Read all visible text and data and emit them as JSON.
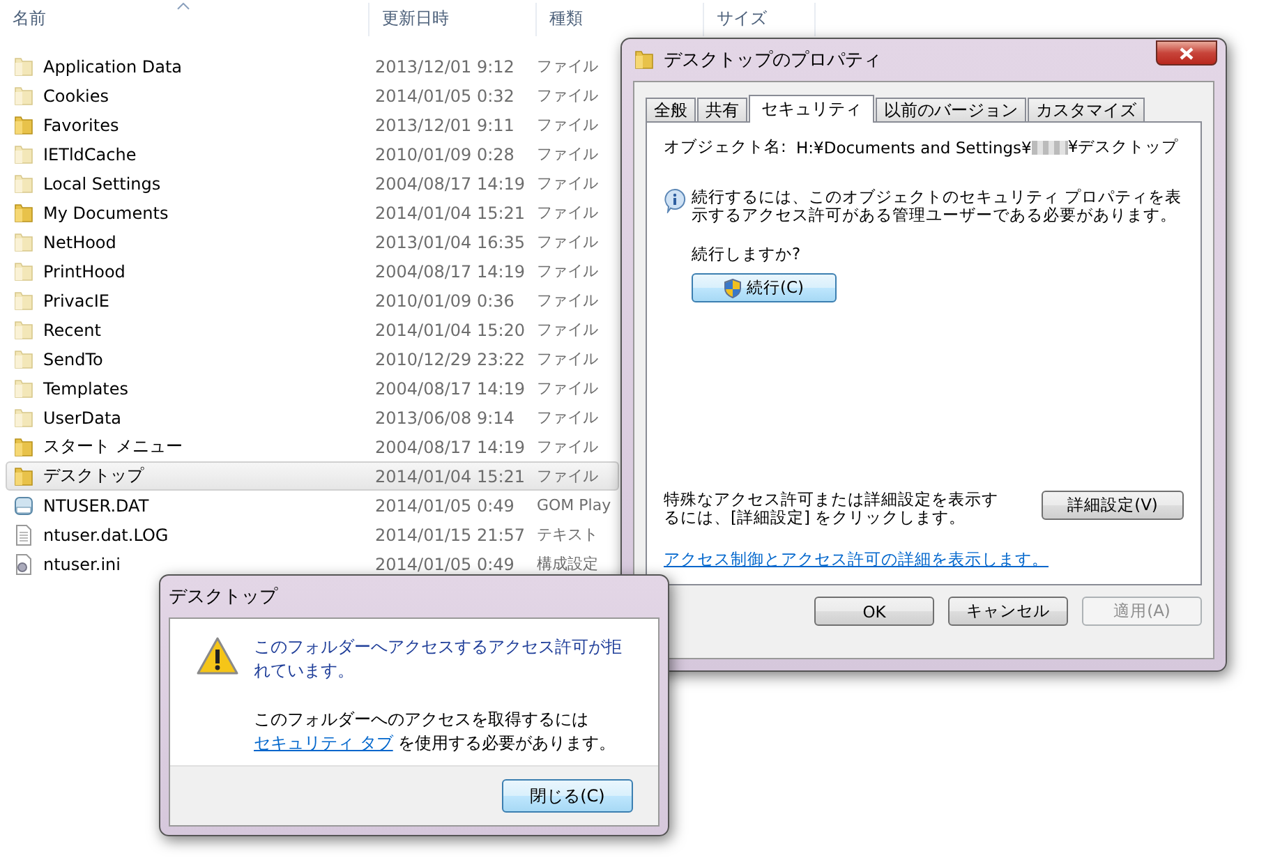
{
  "explorer": {
    "columns": [
      {
        "label": "名前",
        "sorted": true
      },
      {
        "label": "更新日時",
        "sorted": false
      },
      {
        "label": "種類",
        "sorted": false
      },
      {
        "label": "サイズ",
        "sorted": false
      }
    ],
    "rows": [
      {
        "name": "Application Data",
        "date": "2013/12/01 9:12",
        "type": "ファイル",
        "kind": "folder",
        "hidden": true,
        "selected": false
      },
      {
        "name": "Cookies",
        "date": "2014/01/05 0:32",
        "type": "ファイル",
        "kind": "folder",
        "hidden": true,
        "selected": false
      },
      {
        "name": "Favorites",
        "date": "2013/12/01 9:11",
        "type": "ファイル",
        "kind": "folder",
        "hidden": false,
        "selected": false
      },
      {
        "name": "IETldCache",
        "date": "2010/01/09 0:28",
        "type": "ファイル",
        "kind": "folder",
        "hidden": true,
        "selected": false
      },
      {
        "name": "Local Settings",
        "date": "2004/08/17 14:19",
        "type": "ファイル",
        "kind": "folder",
        "hidden": true,
        "selected": false
      },
      {
        "name": "My Documents",
        "date": "2014/01/04 15:21",
        "type": "ファイル",
        "kind": "folder",
        "hidden": false,
        "selected": false
      },
      {
        "name": "NetHood",
        "date": "2013/01/04 16:35",
        "type": "ファイル",
        "kind": "folder",
        "hidden": true,
        "selected": false
      },
      {
        "name": "PrintHood",
        "date": "2004/08/17 14:19",
        "type": "ファイル",
        "kind": "folder",
        "hidden": true,
        "selected": false
      },
      {
        "name": "PrivacIE",
        "date": "2010/01/09 0:36",
        "type": "ファイル",
        "kind": "folder",
        "hidden": true,
        "selected": false
      },
      {
        "name": "Recent",
        "date": "2014/01/04 15:20",
        "type": "ファイル",
        "kind": "folder",
        "hidden": true,
        "selected": false
      },
      {
        "name": "SendTo",
        "date": "2010/12/29 23:22",
        "type": "ファイル",
        "kind": "folder",
        "hidden": true,
        "selected": false
      },
      {
        "name": "Templates",
        "date": "2004/08/17 14:19",
        "type": "ファイル",
        "kind": "folder",
        "hidden": true,
        "selected": false
      },
      {
        "name": "UserData",
        "date": "2013/06/08 9:14",
        "type": "ファイル",
        "kind": "folder",
        "hidden": true,
        "selected": false
      },
      {
        "name": "スタート メニュー",
        "date": "2004/08/17 14:19",
        "type": "ファイル",
        "kind": "folder",
        "hidden": false,
        "selected": false
      },
      {
        "name": "デスクトップ",
        "date": "2014/01/04 15:21",
        "type": "ファイル",
        "kind": "folder",
        "hidden": false,
        "selected": true
      },
      {
        "name": "NTUSER.DAT",
        "date": "2014/01/05 0:49",
        "type": "GOM Play",
        "kind": "dat",
        "selected": false
      },
      {
        "name": "ntuser.dat.LOG",
        "date": "2014/01/15 21:57",
        "type": "テキスト",
        "kind": "text",
        "selected": false
      },
      {
        "name": "ntuser.ini",
        "date": "2014/01/05 0:49",
        "type": "構成設定",
        "kind": "config",
        "selected": false
      }
    ]
  },
  "properties": {
    "title": "デスクトップのプロパティ",
    "tabs": [
      {
        "label": "全般",
        "selected": false
      },
      {
        "label": "共有",
        "selected": false
      },
      {
        "label": "セキュリティ",
        "selected": true
      },
      {
        "label": "以前のバージョン",
        "selected": false
      },
      {
        "label": "カスタマイズ",
        "selected": false
      }
    ],
    "object_label": "オブジェクト名:",
    "object_path_start": "H:¥Documents and Settings¥",
    "object_path_end": "¥デスクトップ",
    "info": "続行するには、このオブジェクトのセキュリティ プロパティを表示するアクセス許可がある管理ユーザーである必要があります。",
    "question": "続行しますか?",
    "continue_button": "続行(C)",
    "advanced_text": "特殊なアクセス許可または詳細設定を表示するには、[詳細設定] をクリックします。",
    "advanced_button": "詳細設定(V)",
    "link": "アクセス制御とアクセス許可の詳細を表示します。",
    "buttons": [
      {
        "label": "OK",
        "disabled": false
      },
      {
        "label": "キャンセル",
        "disabled": false
      },
      {
        "label": "適用(A)",
        "disabled": true
      }
    ]
  },
  "error_dialog": {
    "title": "デスクトップ",
    "message_lines": [
      "このフォルダーへアクセスするアクセス許可が拒",
      "れています。"
    ],
    "hint_before": "このフォルダーへのアクセスを取得するには ",
    "hint_link": "セキュリティ タブ",
    "hint_after": " を使用する必要があります。",
    "close_button": "閉じる(C)"
  }
}
